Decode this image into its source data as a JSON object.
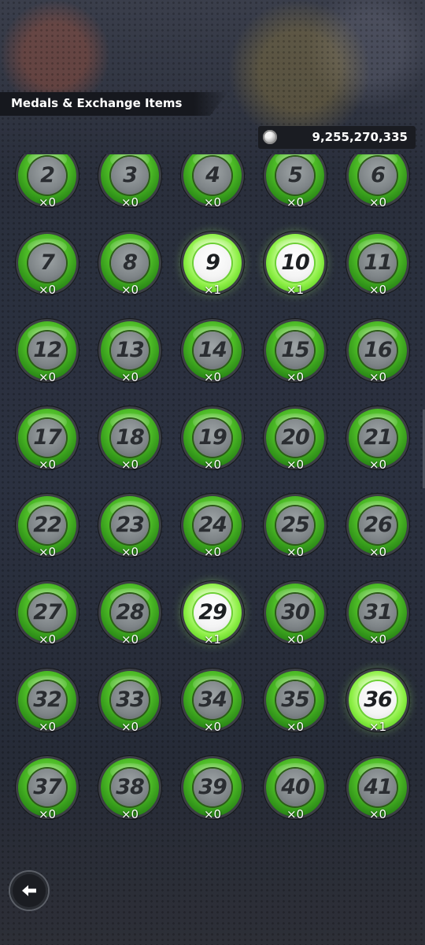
{
  "header": {
    "title": "Medals & Exchange Items"
  },
  "currency": {
    "icon": "coin-icon",
    "amount": "9,255,270,335"
  },
  "colors": {
    "medal_green": "#4cba26",
    "owned_glow": "#dcffb5",
    "background": "#2c3140"
  },
  "medals": [
    {
      "number": "2",
      "count": "×0",
      "owned": false
    },
    {
      "number": "3",
      "count": "×0",
      "owned": false
    },
    {
      "number": "4",
      "count": "×0",
      "owned": false
    },
    {
      "number": "5",
      "count": "×0",
      "owned": false
    },
    {
      "number": "6",
      "count": "×0",
      "owned": false
    },
    {
      "number": "7",
      "count": "×0",
      "owned": false
    },
    {
      "number": "8",
      "count": "×0",
      "owned": false
    },
    {
      "number": "9",
      "count": "×1",
      "owned": true
    },
    {
      "number": "10",
      "count": "×1",
      "owned": true
    },
    {
      "number": "11",
      "count": "×0",
      "owned": false
    },
    {
      "number": "12",
      "count": "×0",
      "owned": false
    },
    {
      "number": "13",
      "count": "×0",
      "owned": false
    },
    {
      "number": "14",
      "count": "×0",
      "owned": false
    },
    {
      "number": "15",
      "count": "×0",
      "owned": false
    },
    {
      "number": "16",
      "count": "×0",
      "owned": false
    },
    {
      "number": "17",
      "count": "×0",
      "owned": false
    },
    {
      "number": "18",
      "count": "×0",
      "owned": false
    },
    {
      "number": "19",
      "count": "×0",
      "owned": false
    },
    {
      "number": "20",
      "count": "×0",
      "owned": false
    },
    {
      "number": "21",
      "count": "×0",
      "owned": false
    },
    {
      "number": "22",
      "count": "×0",
      "owned": false
    },
    {
      "number": "23",
      "count": "×0",
      "owned": false
    },
    {
      "number": "24",
      "count": "×0",
      "owned": false
    },
    {
      "number": "25",
      "count": "×0",
      "owned": false
    },
    {
      "number": "26",
      "count": "×0",
      "owned": false
    },
    {
      "number": "27",
      "count": "×0",
      "owned": false
    },
    {
      "number": "28",
      "count": "×0",
      "owned": false
    },
    {
      "number": "29",
      "count": "×1",
      "owned": true
    },
    {
      "number": "30",
      "count": "×0",
      "owned": false
    },
    {
      "number": "31",
      "count": "×0",
      "owned": false
    },
    {
      "number": "32",
      "count": "×0",
      "owned": false
    },
    {
      "number": "33",
      "count": "×0",
      "owned": false
    },
    {
      "number": "34",
      "count": "×0",
      "owned": false
    },
    {
      "number": "35",
      "count": "×0",
      "owned": false
    },
    {
      "number": "36",
      "count": "×1",
      "owned": true
    },
    {
      "number": "37",
      "count": "×0",
      "owned": false
    },
    {
      "number": "38",
      "count": "×0",
      "owned": false
    },
    {
      "number": "39",
      "count": "×0",
      "owned": false
    },
    {
      "number": "40",
      "count": "×0",
      "owned": false
    },
    {
      "number": "41",
      "count": "×0",
      "owned": false
    }
  ],
  "back_button": {
    "icon": "back-arrow-icon"
  }
}
